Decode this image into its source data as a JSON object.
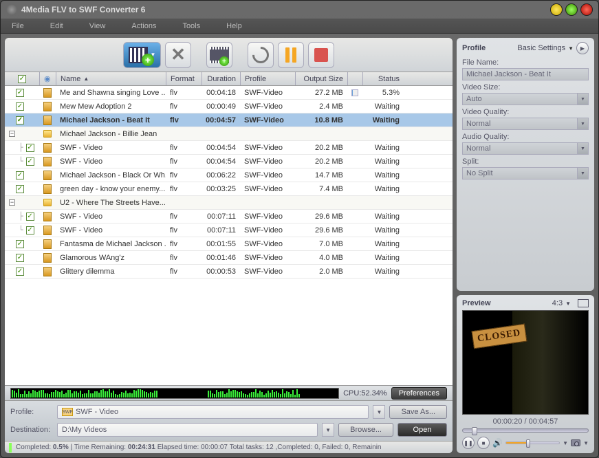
{
  "window": {
    "title": "4Media FLV to SWF Converter 6"
  },
  "menu": {
    "file": "File",
    "edit": "Edit",
    "view": "View",
    "actions": "Actions",
    "tools": "Tools",
    "help": "Help"
  },
  "columns": {
    "name": "Name",
    "format": "Format",
    "duration": "Duration",
    "profile": "Profile",
    "outputSize": "Output Size",
    "status": "Status"
  },
  "rows": [
    {
      "type": "file",
      "indent": 0,
      "checked": true,
      "name": "Me and Shawna singing Love ...",
      "format": "flv",
      "duration": "00:04:18",
      "profile": "SWF-Video",
      "size": "27.2 MB",
      "status": "5.3%",
      "progress": 5.3,
      "selected": false
    },
    {
      "type": "file",
      "indent": 0,
      "checked": true,
      "name": "Mew Mew Adoption 2",
      "format": "flv",
      "duration": "00:00:49",
      "profile": "SWF-Video",
      "size": "2.4 MB",
      "status": "Waiting",
      "selected": false
    },
    {
      "type": "file",
      "indent": 0,
      "checked": true,
      "name": "Michael Jackson - Beat It",
      "format": "flv",
      "duration": "00:04:57",
      "profile": "SWF-Video",
      "size": "10.8 MB",
      "status": "Waiting",
      "selected": true
    },
    {
      "type": "group",
      "expanded": true,
      "name": "Michael Jackson - Billie Jean"
    },
    {
      "type": "file",
      "indent": 1,
      "checked": true,
      "name": "SWF - Video",
      "format": "flv",
      "duration": "00:04:54",
      "profile": "SWF-Video",
      "size": "20.2 MB",
      "status": "Waiting",
      "selected": false
    },
    {
      "type": "file",
      "indent": 1,
      "last": true,
      "checked": true,
      "name": "SWF - Video",
      "format": "flv",
      "duration": "00:04:54",
      "profile": "SWF-Video",
      "size": "20.2 MB",
      "status": "Waiting",
      "selected": false
    },
    {
      "type": "file",
      "indent": 0,
      "checked": true,
      "name": "Michael Jackson - Black Or Wh...",
      "format": "flv",
      "duration": "00:06:22",
      "profile": "SWF-Video",
      "size": "14.7 MB",
      "status": "Waiting",
      "selected": false
    },
    {
      "type": "file",
      "indent": 0,
      "checked": true,
      "name": "green day - know your enemy...",
      "format": "flv",
      "duration": "00:03:25",
      "profile": "SWF-Video",
      "size": "7.4 MB",
      "status": "Waiting",
      "selected": false
    },
    {
      "type": "group",
      "expanded": true,
      "name": "U2 - Where The Streets Have..."
    },
    {
      "type": "file",
      "indent": 1,
      "checked": true,
      "name": "SWF - Video",
      "format": "flv",
      "duration": "00:07:11",
      "profile": "SWF-Video",
      "size": "29.6 MB",
      "status": "Waiting",
      "selected": false
    },
    {
      "type": "file",
      "indent": 1,
      "last": true,
      "checked": true,
      "name": "SWF - Video",
      "format": "flv",
      "duration": "00:07:11",
      "profile": "SWF-Video",
      "size": "29.6 MB",
      "status": "Waiting",
      "selected": false
    },
    {
      "type": "file",
      "indent": 0,
      "checked": true,
      "name": "Fantasma de Michael Jackson ...",
      "format": "flv",
      "duration": "00:01:55",
      "profile": "SWF-Video",
      "size": "7.0 MB",
      "status": "Waiting",
      "selected": false
    },
    {
      "type": "file",
      "indent": 0,
      "checked": true,
      "name": "Glamorous WAng'z",
      "format": "flv",
      "duration": "00:01:46",
      "profile": "SWF-Video",
      "size": "4.0 MB",
      "status": "Waiting",
      "selected": false
    },
    {
      "type": "file",
      "indent": 0,
      "checked": true,
      "name": "Glittery dilemma",
      "format": "flv",
      "duration": "00:00:53",
      "profile": "SWF-Video",
      "size": "2.0 MB",
      "status": "Waiting",
      "selected": false
    }
  ],
  "cpu": {
    "label": "CPU:52.34%",
    "preferences": "Preferences"
  },
  "bottom": {
    "profileLabel": "Profile:",
    "profileValue": "SWF - Video",
    "saveAs": "Save As...",
    "destLabel": "Destination:",
    "destValue": "D:\\My Videos",
    "browse": "Browse...",
    "open": "Open"
  },
  "status": {
    "completedLbl": "Completed:",
    "completedVal": "0.5%",
    "timeRemLbl": "Time Remaining:",
    "timeRemVal": "00:24:31",
    "elapsedLbl": "Elapsed time:",
    "elapsedVal": "00:00:07",
    "totalLbl": "Total tasks:",
    "totalVal": "12",
    "compLbl": "Completed:",
    "compVal": "0",
    "failLbl": "Failed:",
    "failVal": "0",
    "remLbl": "Remainin"
  },
  "profilePanel": {
    "title": "Profile",
    "settings": "Basic Settings",
    "fileNameLbl": "File Name:",
    "fileName": "Michael Jackson - Beat It",
    "videoSizeLbl": "Video Size:",
    "videoSize": "Auto",
    "videoQualityLbl": "Video Quality:",
    "videoQuality": "Normal",
    "audioQualityLbl": "Audio Quality:",
    "audioQuality": "Normal",
    "splitLbl": "Split:",
    "split": "No Split"
  },
  "preview": {
    "title": "Preview",
    "aspect": "4:3",
    "time": "00:00:20 / 00:04:57",
    "closedSign": "CLOSED",
    "sliderPos": 7,
    "volumePos": 40
  }
}
